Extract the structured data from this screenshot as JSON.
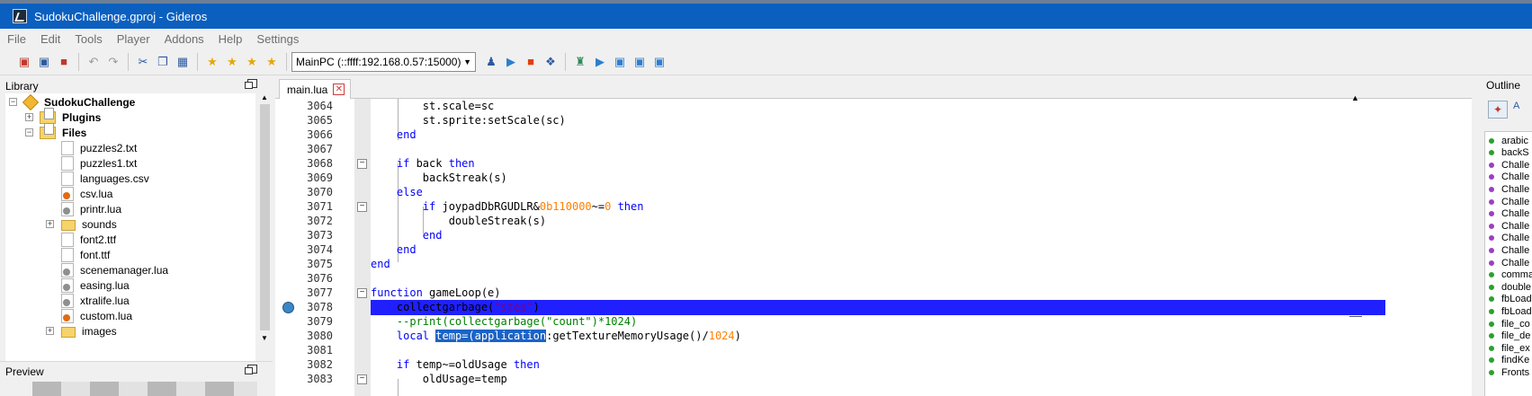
{
  "window": {
    "title": "SudokuChallenge.gproj - Gideros"
  },
  "menu": [
    "File",
    "Edit",
    "Tools",
    "Player",
    "Addons",
    "Help",
    "Settings"
  ],
  "toolbar": {
    "target": "MainPC (::ffff:192.168.0.57:15000)"
  },
  "library": {
    "title": "Library",
    "items": [
      {
        "label": "SudokuChallenge",
        "icon": "project-icon",
        "bold": true
      },
      {
        "label": "Plugins",
        "icon": "folder-icon",
        "bold": true
      },
      {
        "label": "Files",
        "icon": "folder-icon",
        "bold": true
      },
      {
        "label": "puzzles2.txt",
        "icon": "file-icon"
      },
      {
        "label": "puzzles1.txt",
        "icon": "file-icon"
      },
      {
        "label": "languages.csv",
        "icon": "file-icon"
      },
      {
        "label": "csv.lua",
        "icon": "lua-file-icon"
      },
      {
        "label": "printr.lua",
        "icon": "lua-file-icon"
      },
      {
        "label": "sounds",
        "icon": "folder-icon"
      },
      {
        "label": "font2.ttf",
        "icon": "file-icon"
      },
      {
        "label": "font.ttf",
        "icon": "file-icon"
      },
      {
        "label": "scenemanager.lua",
        "icon": "lua-file-icon"
      },
      {
        "label": "easing.lua",
        "icon": "lua-file-icon"
      },
      {
        "label": "xtralife.lua",
        "icon": "lua-file-icon"
      },
      {
        "label": "custom.lua",
        "icon": "lua-file-icon"
      },
      {
        "label": "images",
        "icon": "folder-icon"
      }
    ]
  },
  "preview": {
    "title": "Preview"
  },
  "editor": {
    "tab": "main.lua",
    "lines": [
      {
        "num": "3064",
        "code": "        st.scale=sc"
      },
      {
        "num": "3065",
        "code": "        st.sprite:setScale(sc)"
      },
      {
        "num": "3066",
        "code": "    end"
      },
      {
        "num": "3067",
        "code": ""
      },
      {
        "num": "3068",
        "code": "    if back then"
      },
      {
        "num": "3069",
        "code": "        backStreak(s)"
      },
      {
        "num": "3070",
        "code": "    else"
      },
      {
        "num": "3071",
        "code": "        if joypadDbRGUDLR&0b110000~=0 then"
      },
      {
        "num": "3072",
        "code": "            doubleStreak(s)"
      },
      {
        "num": "3073",
        "code": "        end"
      },
      {
        "num": "3074",
        "code": "    end"
      },
      {
        "num": "3075",
        "code": "end"
      },
      {
        "num": "3076",
        "code": ""
      },
      {
        "num": "3077",
        "code": "function gameLoop(e)"
      },
      {
        "num": "3078",
        "code": "    collectgarbage(\"step\")"
      },
      {
        "num": "3079",
        "code": "    --print(collectgarbage(\"count\")*1024)"
      },
      {
        "num": "3080",
        "code": "    local temp=(application:getTextureMemoryUsage()/1024)"
      },
      {
        "num": "3081",
        "code": ""
      },
      {
        "num": "3082",
        "code": "    if temp~=oldUsage then"
      },
      {
        "num": "3083",
        "code": "        oldUsage=temp"
      }
    ]
  },
  "outline": {
    "title": "Outline",
    "items": [
      {
        "label": "arabic",
        "color": "#2ca02c"
      },
      {
        "label": "backS",
        "color": "#2ca02c"
      },
      {
        "label": "Challe",
        "color": "#9b3fbf"
      },
      {
        "label": "Challe",
        "color": "#9b3fbf"
      },
      {
        "label": "Challe",
        "color": "#9b3fbf"
      },
      {
        "label": "Challe",
        "color": "#9b3fbf"
      },
      {
        "label": "Challe",
        "color": "#9b3fbf"
      },
      {
        "label": "Challe",
        "color": "#9b3fbf"
      },
      {
        "label": "Challe",
        "color": "#9b3fbf"
      },
      {
        "label": "Challe",
        "color": "#9b3fbf"
      },
      {
        "label": "Challe",
        "color": "#9b3fbf"
      },
      {
        "label": "comma",
        "color": "#2ca02c"
      },
      {
        "label": "double",
        "color": "#2ca02c"
      },
      {
        "label": "fbLoad",
        "color": "#2ca02c"
      },
      {
        "label": "fbLoad",
        "color": "#2ca02c"
      },
      {
        "label": "file_co",
        "color": "#2ca02c"
      },
      {
        "label": "file_de",
        "color": "#2ca02c"
      },
      {
        "label": "file_ex",
        "color": "#2ca02c"
      },
      {
        "label": "findKe",
        "color": "#2ca02c"
      },
      {
        "label": "Fronts",
        "color": "#2ca02c"
      }
    ]
  }
}
